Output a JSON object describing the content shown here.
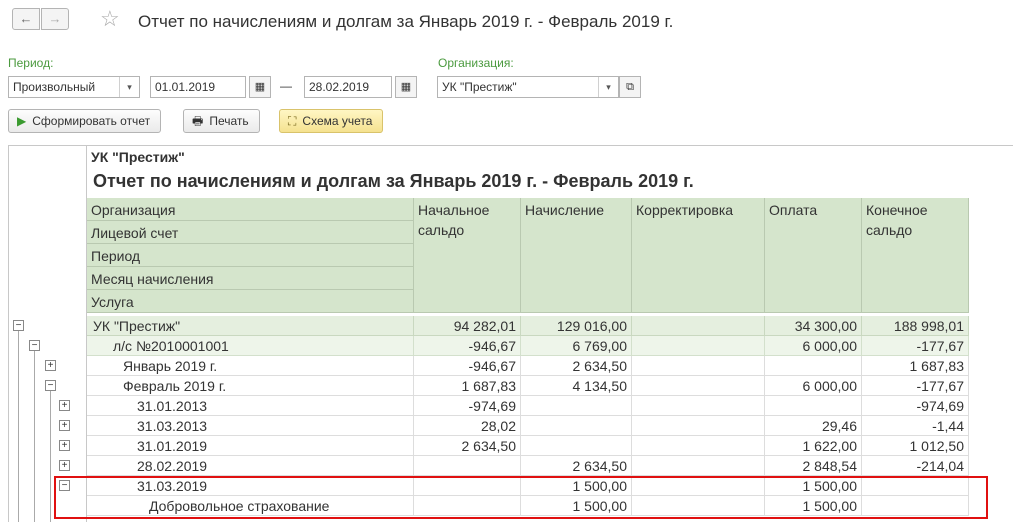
{
  "window": {
    "title": "Отчет по начислениям и долгам за Январь 2019 г. - Февраль 2019 г.",
    "back_glyph": "←",
    "forward_glyph": "→",
    "star_glyph": "☆"
  },
  "filters": {
    "period_label": "Период:",
    "period_type": "Произвольный",
    "date_from": "01.01.2019",
    "date_to": "28.02.2019",
    "dash": "—",
    "org_label": "Организация:",
    "org_value": "УК \"Престиж\"",
    "dropdown_glyph": "▾",
    "calendar_glyph": "▦",
    "open_glyph": "⧉"
  },
  "toolbar": {
    "generate_label": "Сформировать отчет",
    "print_label": "Печать",
    "scheme_label": "Схема учета",
    "generate_icon": "play-icon",
    "print_icon": "printer-icon",
    "scheme_icon": "scheme-icon"
  },
  "report": {
    "org_title": "УК \"Престиж\"",
    "title": "Отчет по начислениям и долгам за Январь 2019 г. - Февраль 2019 г.",
    "grouping_headers": [
      "Организация",
      "Лицевой счет",
      "Период",
      "Месяц начисления",
      "Услуга"
    ],
    "columns": [
      "Начальное сальдо",
      "Начисление",
      "Корректировка",
      "Оплата",
      "Конечное сальдо"
    ],
    "rows": [
      {
        "label": "УК \"Престиж\"",
        "level": 0,
        "toggle": "−",
        "start": "94 282,01",
        "accrual": "129 016,00",
        "corr": "",
        "payment": "34 300,00",
        "end": "188 998,01"
      },
      {
        "label": "л/с №2010001001",
        "level": 1,
        "toggle": "−",
        "start": "-946,67",
        "accrual": "6 769,00",
        "corr": "",
        "payment": "6 000,00",
        "end": "-177,67"
      },
      {
        "label": "Январь 2019  г.",
        "level": 2,
        "toggle": "+",
        "start": "-946,67",
        "accrual": "2 634,50",
        "corr": "",
        "payment": "",
        "end": "1 687,83"
      },
      {
        "label": "Февраль 2019  г.",
        "level": 2,
        "toggle": "−",
        "start": "1 687,83",
        "accrual": "4 134,50",
        "corr": "",
        "payment": "6 000,00",
        "end": "-177,67"
      },
      {
        "label": "31.01.2013",
        "level": 3,
        "toggle": "+",
        "start": "-974,69",
        "accrual": "",
        "corr": "",
        "payment": "",
        "end": "-974,69"
      },
      {
        "label": "31.03.2013",
        "level": 3,
        "toggle": "+",
        "start": "28,02",
        "accrual": "",
        "corr": "",
        "payment": "29,46",
        "end": "-1,44"
      },
      {
        "label": "31.01.2019",
        "level": 3,
        "toggle": "+",
        "start": "2 634,50",
        "accrual": "",
        "corr": "",
        "payment": "1 622,00",
        "end": "1 012,50"
      },
      {
        "label": "28.02.2019",
        "level": 3,
        "toggle": "+",
        "start": "",
        "accrual": "2 634,50",
        "corr": "",
        "payment": "2 848,54",
        "end": "-214,04"
      },
      {
        "label": "31.03.2019",
        "level": 3,
        "toggle": "−",
        "start": "",
        "accrual": "1 500,00",
        "corr": "",
        "payment": "1 500,00",
        "end": ""
      },
      {
        "label": "Добровольное страхование",
        "level": 4,
        "toggle": "",
        "start": "",
        "accrual": "1 500,00",
        "corr": "",
        "payment": "1 500,00",
        "end": ""
      }
    ]
  },
  "colors": {
    "header_bg": "#d5e5cc",
    "group_bg": "#e5efdf",
    "label_green": "#4b9a3f",
    "highlight_red": "#e01010"
  }
}
